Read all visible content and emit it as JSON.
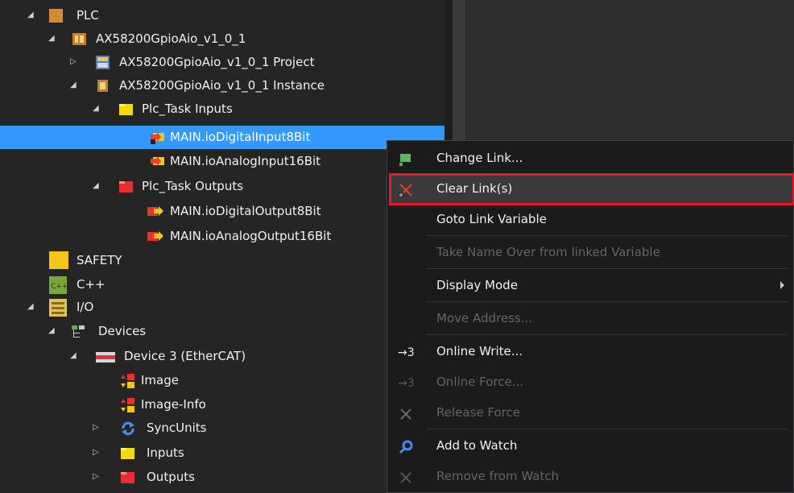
{
  "tree": {
    "items": [
      {
        "label": "PLC"
      },
      {
        "label": "AX58200GpioAio_v1_0_1"
      },
      {
        "label": "AX58200GpioAio_v1_0_1 Project"
      },
      {
        "label": "AX58200GpioAio_v1_0_1 Instance"
      },
      {
        "label": "Plc_Task Inputs"
      },
      {
        "label": "MAIN.ioDigitalInput8Bit"
      },
      {
        "label": "MAIN.ioAnalogInput16Bit"
      },
      {
        "label": "Plc_Task Outputs"
      },
      {
        "label": "MAIN.ioDigitalOutput8Bit"
      },
      {
        "label": "MAIN.ioAnalogOutput16Bit"
      },
      {
        "label": "SAFETY"
      },
      {
        "label": "C++"
      },
      {
        "label": "I/O"
      },
      {
        "label": "Devices"
      },
      {
        "label": "Device 3 (EtherCAT)"
      },
      {
        "label": "Image"
      },
      {
        "label": "Image-Info"
      },
      {
        "label": "SyncUnits"
      },
      {
        "label": "Inputs"
      },
      {
        "label": "Outputs"
      }
    ]
  },
  "menu": {
    "items": [
      {
        "label": "Change Link..."
      },
      {
        "label": "Clear Link(s)"
      },
      {
        "label": "Goto Link Variable"
      },
      {
        "label": "Take Name Over from linked Variable"
      },
      {
        "label": "Display Mode"
      },
      {
        "label": "Move Address..."
      },
      {
        "label": "Online Write..."
      },
      {
        "label": "Online Force..."
      },
      {
        "label": "Release Force"
      },
      {
        "label": "Add to Watch"
      },
      {
        "label": "Remove from Watch"
      }
    ]
  },
  "colors": {
    "selection": "#3399ff",
    "highlight_border": "#e31b23",
    "menu_bg": "#1b1b1c"
  }
}
